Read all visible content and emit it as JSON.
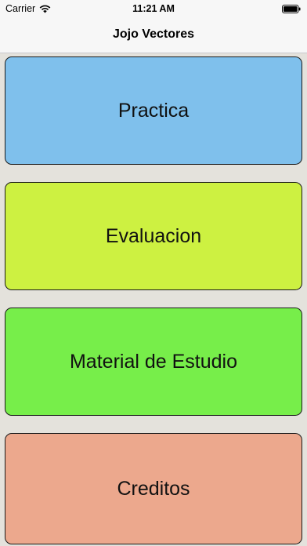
{
  "status_bar": {
    "carrier": "Carrier",
    "time": "11:21 AM",
    "icons": [
      "wifi-icon",
      "battery-icon"
    ]
  },
  "nav": {
    "title": "Jojo Vectores"
  },
  "menu": {
    "items": [
      {
        "label": "Practica",
        "color": "#7fc0ec"
      },
      {
        "label": "Evaluacion",
        "color": "#cdf141"
      },
      {
        "label": "Material de Estudio",
        "color": "#77ee4a"
      },
      {
        "label": "Creditos",
        "color": "#eca88d"
      }
    ]
  },
  "colors": {
    "background": "#e4e2dc",
    "nav_background": "#f7f7f7"
  }
}
